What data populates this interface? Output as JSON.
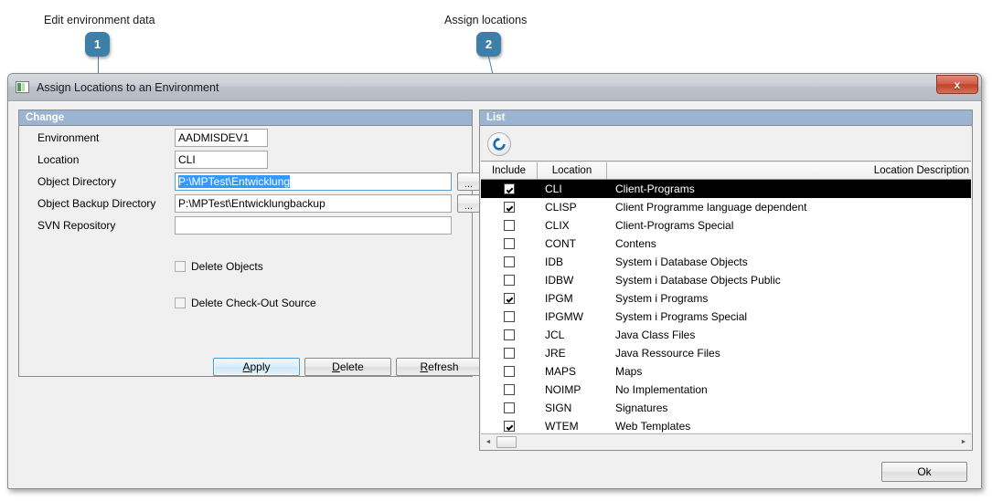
{
  "annotations": [
    {
      "number": "1",
      "label": "Edit environment data"
    },
    {
      "number": "2",
      "label": "Assign locations"
    }
  ],
  "window": {
    "title": "Assign Locations to an Environment",
    "icon": "app-icon",
    "close_label": "x"
  },
  "left_panel": {
    "header": "Change",
    "fields": [
      {
        "label": "Environment",
        "value": "AADMISDEV1",
        "size": "short",
        "focused": false,
        "browse": false
      },
      {
        "label": "Location",
        "value": "CLI",
        "size": "short",
        "focused": false,
        "browse": false
      },
      {
        "label": "Object Directory",
        "value": "P:\\MPTest\\Entwicklung",
        "size": "long",
        "focused": true,
        "selected": true,
        "browse": true
      },
      {
        "label": "Object Backup Directory",
        "value": "P:\\MPTest\\Entwicklungbackup",
        "size": "long",
        "focused": false,
        "browse": true
      },
      {
        "label": "SVN Repository",
        "value": "",
        "size": "long",
        "focused": false,
        "browse": false
      }
    ],
    "browse_button_label": "...",
    "checkboxes": [
      {
        "label": "Delete Objects",
        "checked": false
      },
      {
        "label": "Delete Check-Out Source",
        "checked": false
      }
    ],
    "buttons": [
      {
        "label": "Apply",
        "mnemonic": "A",
        "rest": "pply",
        "primary": true
      },
      {
        "label": "Delete",
        "mnemonic": "D",
        "rest": "elete",
        "primary": false
      },
      {
        "label": "Refresh",
        "mnemonic": "R",
        "rest": "efresh",
        "primary": false
      }
    ]
  },
  "right_panel": {
    "header": "List",
    "toolbar": {
      "refresh_icon": "refresh-icon"
    },
    "columns": [
      "Include",
      "Location",
      "Location Description"
    ],
    "rows": [
      {
        "include": true,
        "location": "CLI",
        "description": "Client-Programs",
        "selected": true
      },
      {
        "include": true,
        "location": "CLISP",
        "description": "Client Programme language dependent",
        "selected": false
      },
      {
        "include": false,
        "location": "CLIX",
        "description": "Client-Programs Special",
        "selected": false
      },
      {
        "include": false,
        "location": "CONT",
        "description": "Contens",
        "selected": false
      },
      {
        "include": false,
        "location": "IDB",
        "description": "System i Database Objects",
        "selected": false
      },
      {
        "include": false,
        "location": "IDBW",
        "description": "System i Database Objects Public",
        "selected": false
      },
      {
        "include": true,
        "location": "IPGM",
        "description": "System i Programs",
        "selected": false
      },
      {
        "include": false,
        "location": "IPGMW",
        "description": "System i Programs Special",
        "selected": false
      },
      {
        "include": false,
        "location": "JCL",
        "description": "Java Class Files",
        "selected": false
      },
      {
        "include": false,
        "location": "JRE",
        "description": "Java Ressource Files",
        "selected": false
      },
      {
        "include": false,
        "location": "MAPS",
        "description": "Maps",
        "selected": false
      },
      {
        "include": false,
        "location": "NOIMP",
        "description": "No Implementation",
        "selected": false
      },
      {
        "include": false,
        "location": "SIGN",
        "description": "Signatures",
        "selected": false
      },
      {
        "include": true,
        "location": "WTEM",
        "description": "Web Templates",
        "selected": false
      }
    ],
    "scrollbar": {
      "left_arrow": "◄",
      "right_arrow": "►"
    }
  },
  "footer": {
    "ok_label": "Ok"
  },
  "colors": {
    "accent": "#3d7fa6",
    "panel_header": "#9ab4d2",
    "selection": "#3399ff",
    "close_button": "#c04528"
  }
}
